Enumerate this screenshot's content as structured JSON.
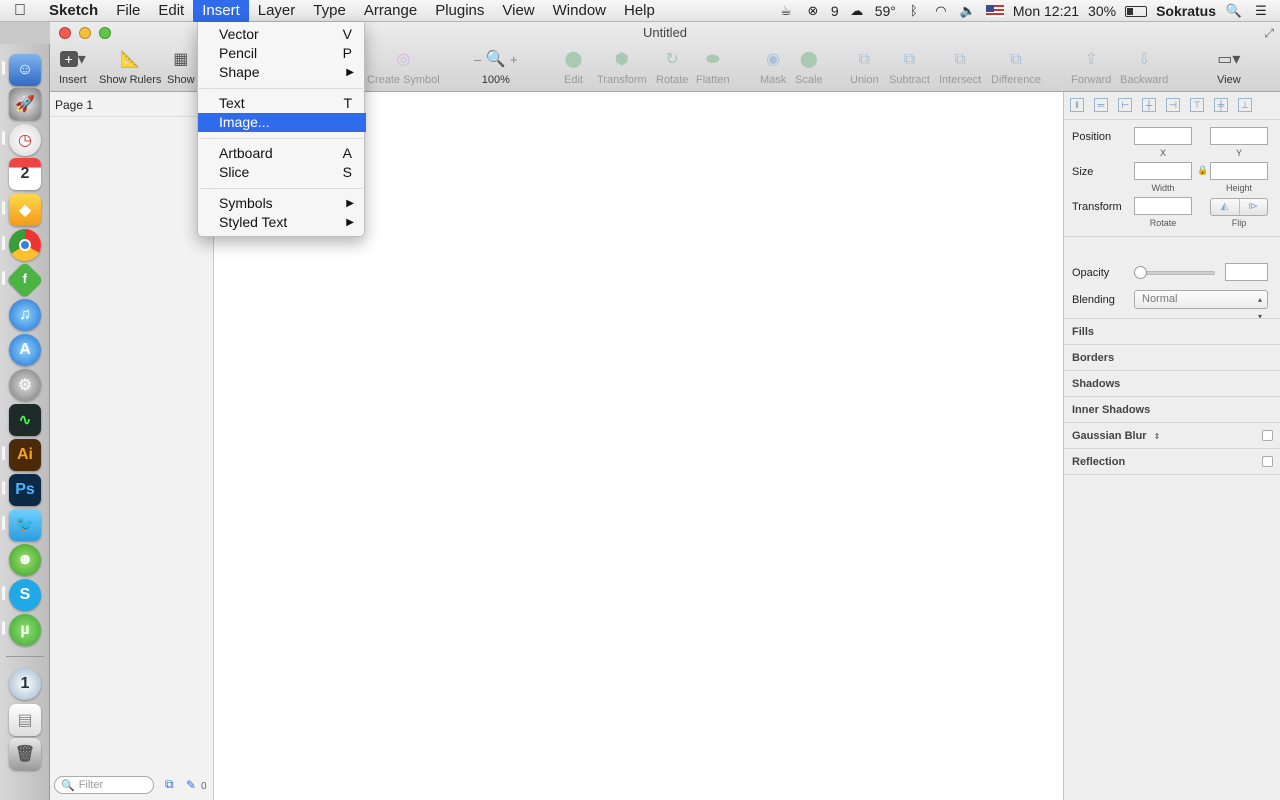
{
  "menubar": {
    "app_name": "Sketch",
    "items": [
      "File",
      "Edit",
      "Insert",
      "Layer",
      "Type",
      "Arrange",
      "Plugins",
      "View",
      "Window",
      "Help"
    ],
    "active_item": "Insert",
    "status": {
      "notification_count": "9",
      "temperature": "59°",
      "clock": "Mon 12:21",
      "battery": "30%",
      "user": "Sokratus"
    }
  },
  "insert_menu": {
    "items": [
      {
        "label": "Vector",
        "shortcut": "V"
      },
      {
        "label": "Pencil",
        "shortcut": "P"
      },
      {
        "label": "Shape",
        "submenu": "▶"
      },
      {
        "label": "Text",
        "shortcut": "T"
      },
      {
        "label": "Image...",
        "highlighted": true
      },
      {
        "label": "Artboard",
        "shortcut": "A"
      },
      {
        "label": "Slice",
        "shortcut": "S"
      },
      {
        "label": "Symbols",
        "submenu": "▶"
      },
      {
        "label": "Styled Text",
        "submenu": "▶"
      }
    ]
  },
  "window": {
    "title": "Untitled",
    "toolbar": {
      "insert": "Insert",
      "show_rulers": "Show Rulers",
      "show": "Show",
      "create_symbol": "Create Symbol",
      "zoom": "100%",
      "zoom_minus": "–",
      "zoom_plus": "+",
      "edit": "Edit",
      "transform": "Transform",
      "rotate": "Rotate",
      "flatten": "Flatten",
      "mask": "Mask",
      "scale": "Scale",
      "union": "Union",
      "subtract": "Subtract",
      "intersect": "Intersect",
      "difference": "Difference",
      "forward": "Forward",
      "backward": "Backward",
      "view": "View"
    }
  },
  "layers": {
    "page": "Page 1",
    "filter_placeholder": "Filter",
    "count": "0"
  },
  "inspector": {
    "position": "Position",
    "x": "X",
    "y": "Y",
    "size": "Size",
    "width": "Width",
    "height": "Height",
    "transform": "Transform",
    "rotate": "Rotate",
    "flip": "Flip",
    "opacity": "Opacity",
    "blending": "Blending",
    "blending_value": "Normal",
    "sections": [
      "Fills",
      "Borders",
      "Shadows",
      "Inner Shadows",
      "Gaussian Blur",
      "Reflection"
    ]
  },
  "colors": {
    "accent": "#2f6bea",
    "menubar": "#ececec",
    "inspector_bg": "#eeeeee"
  },
  "icons": {
    "apple": "apple-logo-icon",
    "search": "spotlight-search-icon",
    "list": "notification-list-icon"
  }
}
